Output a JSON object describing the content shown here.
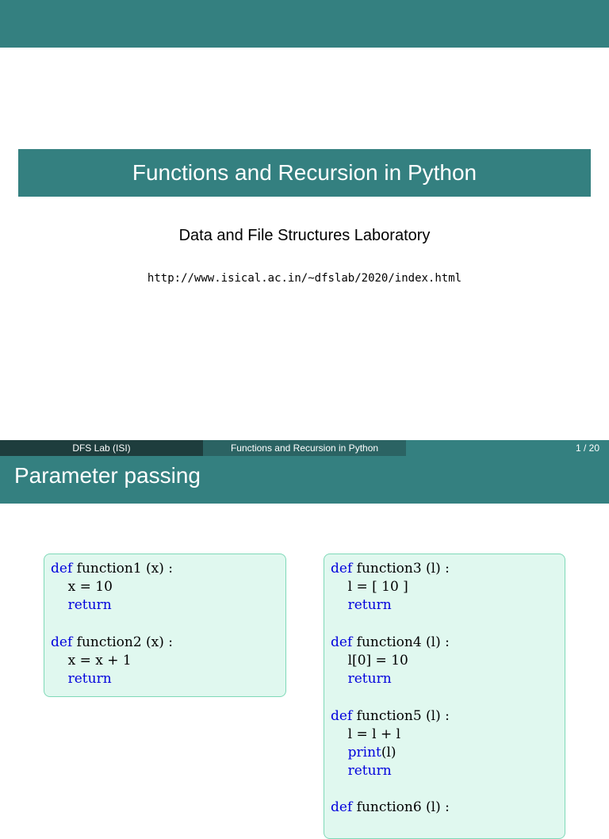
{
  "title_slide": {
    "title": "Functions and Recursion in Python",
    "subtitle": "Data and File Structures Laboratory",
    "url": "http://www.isical.ac.in/~dfslab/2020/index.html"
  },
  "footer": {
    "left": "DFS Lab  (ISI)",
    "center": "Functions and Recursion in Python",
    "page": "1 / 20"
  },
  "slide2": {
    "title": "Parameter passing",
    "left_code": [
      {
        "pre": "",
        "kw": "def",
        "rest": " function1 (x) :"
      },
      {
        "pre": "    ",
        "kw": "",
        "rest": "x = 10"
      },
      {
        "pre": "    ",
        "kw": "return",
        "rest": ""
      },
      {
        "pre": "",
        "kw": "",
        "rest": ""
      },
      {
        "pre": "",
        "kw": "def",
        "rest": " function2 (x) :"
      },
      {
        "pre": "    ",
        "kw": "",
        "rest": "x = x + 1"
      },
      {
        "pre": "    ",
        "kw": "return",
        "rest": ""
      }
    ],
    "right_code": [
      {
        "pre": "",
        "kw": "def",
        "rest": " function3 (l) :"
      },
      {
        "pre": "    ",
        "kw": "",
        "rest": "l = [ 10 ]"
      },
      {
        "pre": "    ",
        "kw": "return",
        "rest": ""
      },
      {
        "pre": "",
        "kw": "",
        "rest": ""
      },
      {
        "pre": "",
        "kw": "def",
        "rest": " function4 (l) :"
      },
      {
        "pre": "    ",
        "kw": "",
        "rest": "l[0] = 10"
      },
      {
        "pre": "    ",
        "kw": "return",
        "rest": ""
      },
      {
        "pre": "",
        "kw": "",
        "rest": ""
      },
      {
        "pre": "",
        "kw": "def",
        "rest": " function5 (l) :"
      },
      {
        "pre": "    ",
        "kw": "",
        "rest": "l = l + l"
      },
      {
        "pre": "    ",
        "kw": "print",
        "rest": "(l)"
      },
      {
        "pre": "    ",
        "kw": "return",
        "rest": ""
      },
      {
        "pre": "",
        "kw": "",
        "rest": ""
      },
      {
        "pre": "",
        "kw": "def",
        "rest": " function6 (l) :"
      }
    ]
  }
}
